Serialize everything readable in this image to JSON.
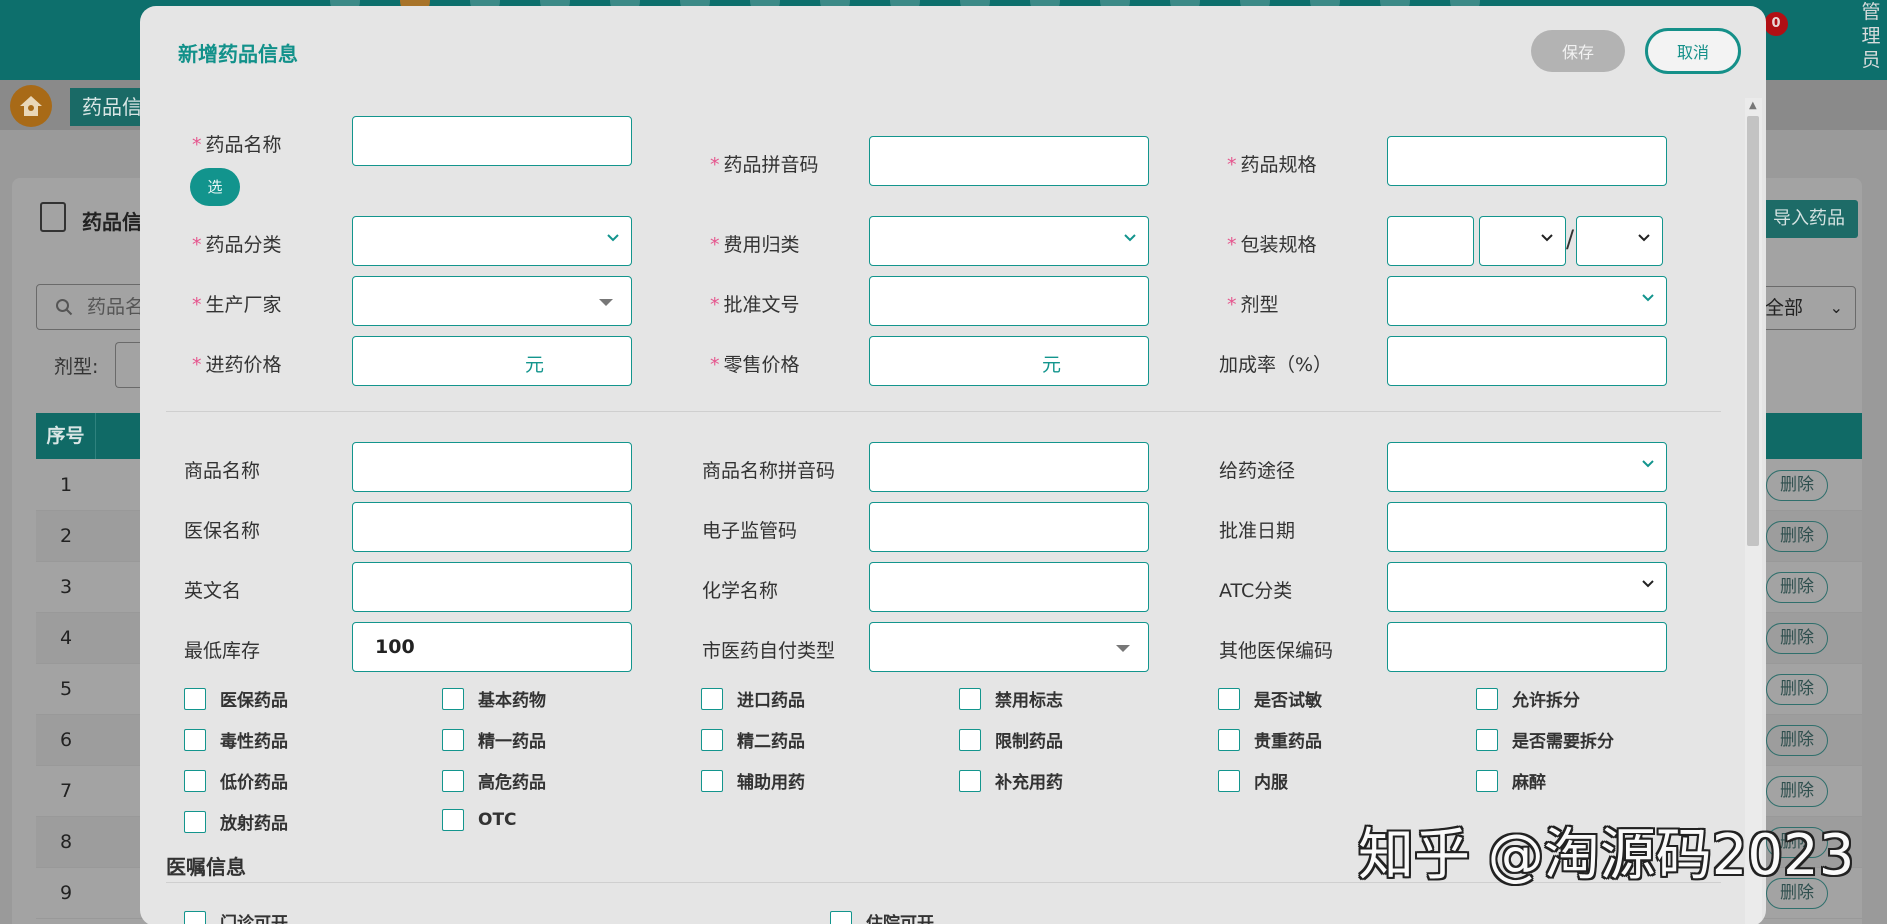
{
  "header": {
    "notification_count": "0",
    "user_role": "管理员"
  },
  "breadcrumb": {
    "tab_label": "药品信息"
  },
  "background": {
    "card_title": "药品信息",
    "import_button": "导入药品",
    "search_placeholder": "药品名称",
    "dosage_label": "剂型:",
    "right_select": "全部",
    "table": {
      "index_header": "序号",
      "rows": [
        "1",
        "2",
        "3",
        "4",
        "5",
        "6",
        "7",
        "8",
        "9"
      ],
      "delete_label": "删除"
    }
  },
  "modal": {
    "title": "新增药品信息",
    "save_button": "保存",
    "cancel_button": "取消",
    "pick_button": "选",
    "fields": {
      "drug_name": "药品名称",
      "drug_pinyin": "药品拼音码",
      "drug_spec": "药品规格",
      "drug_category": "药品分类",
      "fee_category": "费用归类",
      "package_spec": "包装规格",
      "manufacturer": "生产厂家",
      "approval_number": "批准文号",
      "dosage_form": "剂型",
      "purchase_price": "进药价格",
      "retail_price": "零售价格",
      "markup_rate": "加成率（%）",
      "trade_name": "商品名称",
      "trade_name_pinyin": "商品名称拼音码",
      "route": "给药途径",
      "insurance_name": "医保名称",
      "e_supervision_code": "电子监管码",
      "approval_date": "批准日期",
      "english_name": "英文名",
      "chemical_name": "化学名称",
      "atc_category": "ATC分类",
      "min_stock": "最低库存",
      "self_pay_type": "市医药自付类型",
      "other_insurance_code": "其他医保编码"
    },
    "values": {
      "min_stock": "100"
    },
    "units": {
      "purchase_price": "元",
      "retail_price": "元"
    },
    "package_separator": "/",
    "checkboxes": [
      "医保药品",
      "基本药物",
      "进口药品",
      "禁用标志",
      "是否试敏",
      "允许拆分",
      "毒性药品",
      "精一药品",
      "精二药品",
      "限制药品",
      "贵重药品",
      "是否需要拆分",
      "低价药品",
      "高危药品",
      "辅助用药",
      "补充用药",
      "内服",
      "麻醉",
      "放射药品",
      "OTC"
    ],
    "orders_section": {
      "title": "医嘱信息",
      "checkboxes": [
        "门诊可开",
        "住院可开"
      ]
    }
  },
  "watermark": "知乎 @淘源码2023"
}
